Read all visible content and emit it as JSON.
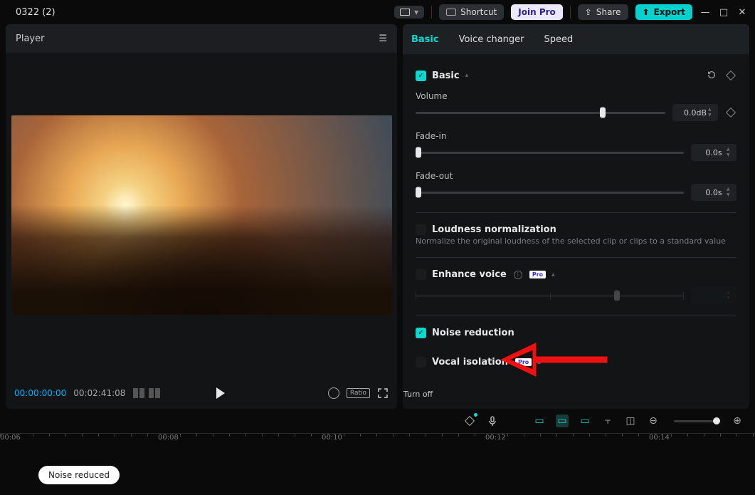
{
  "project_title": "0322 (2)",
  "topbar": {
    "shortcut": "Shortcut",
    "join_pro": "Join Pro",
    "share": "Share",
    "export": "Export"
  },
  "player": {
    "title": "Player",
    "current_time": "00:00:00:00",
    "duration": "00:02:41:08",
    "ratio_label": "Ratio"
  },
  "props": {
    "tabs": {
      "basic": "Basic",
      "voice_changer": "Voice changer",
      "speed": "Speed"
    },
    "basic_section": "Basic",
    "volume": {
      "label": "Volume",
      "value": "0.0dB"
    },
    "fade_in": {
      "label": "Fade-in",
      "value": "0.0s"
    },
    "fade_out": {
      "label": "Fade-out",
      "value": "0.0s"
    },
    "loudness": {
      "title": "Loudness normalization",
      "desc": "Normalize the original loudness of the selected clip or clips to a standard value"
    },
    "enhance_voice": {
      "title": "Enhance voice",
      "pro": "Pro"
    },
    "noise_reduction": {
      "title": "Noise reduction"
    },
    "vocal_isolation": {
      "title": "Vocal isolation",
      "pro": "Pro"
    },
    "tooltip_off": "Turn off"
  },
  "timeline": {
    "ticks": [
      "00:06",
      "00:08",
      "00:10",
      "00:12",
      "00:14"
    ]
  },
  "toast": "Noise reduced"
}
